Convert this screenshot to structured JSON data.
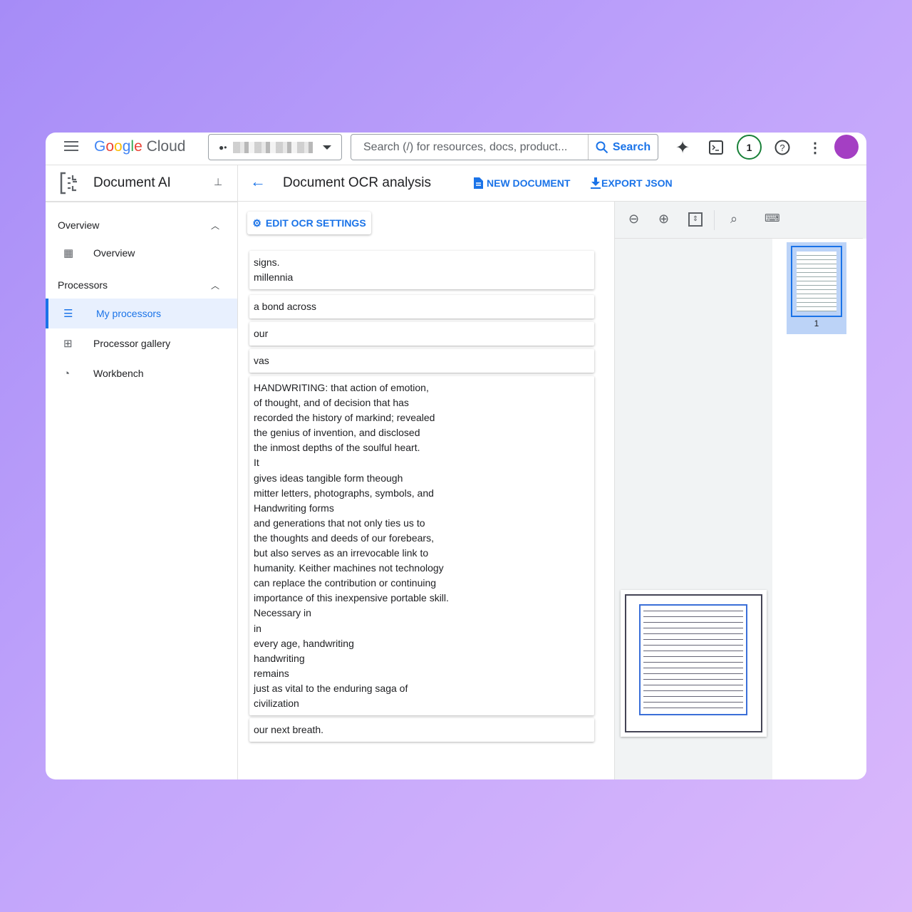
{
  "header": {
    "logo_text": "Google Cloud",
    "search_placeholder": "Search (/) for resources, docs, product...",
    "search_button": "Search",
    "notification_count": "1"
  },
  "product": {
    "title": "Document AI"
  },
  "page": {
    "title": "Document OCR analysis",
    "new_document": "NEW DOCUMENT",
    "export_json": "EXPORT JSON",
    "edit_ocr_settings": "EDIT OCR SETTINGS"
  },
  "sidebar": {
    "sections": [
      {
        "label": "Overview",
        "items": [
          {
            "label": "Overview"
          }
        ]
      },
      {
        "label": "Processors",
        "items": [
          {
            "label": "My processors",
            "selected": true
          },
          {
            "label": "Processor gallery"
          },
          {
            "label": "Workbench"
          }
        ]
      }
    ]
  },
  "ocr_blocks": [
    [
      "signs.",
      "millennia"
    ],
    [
      "a bond across"
    ],
    [
      "our"
    ],
    [
      "vas"
    ],
    [
      "HANDWRITING: that action of emotion,",
      "of thought, and of decision that has",
      "recorded the history of markind; revealed",
      "the genius of invention, and disclosed",
      "the inmost depths of the soulful heart.",
      "It",
      "gives ideas tangible form theough",
      "mitter letters, photographs, symbols, and",
      "Handwriting forms",
      "and generations that not only ties us to",
      "the thoughts and deeds of our forebears,",
      "but also serves as an irrevocable link to",
      "humanity. Keither machines not technology",
      "can replace the contribution or continuing",
      "importance of this inexpensive portable skill.",
      "Necessary in",
      "in",
      "every age, handwriting",
      "handwriting",
      "remains",
      "just as vital to the enduring saga of",
      "civilization"
    ],
    [
      "our next breath."
    ]
  ],
  "viewer": {
    "page_number": "1"
  },
  "colors": {
    "accent": "#1a73e8",
    "selected_bg": "#e8f0fe",
    "notification": "#188038"
  }
}
